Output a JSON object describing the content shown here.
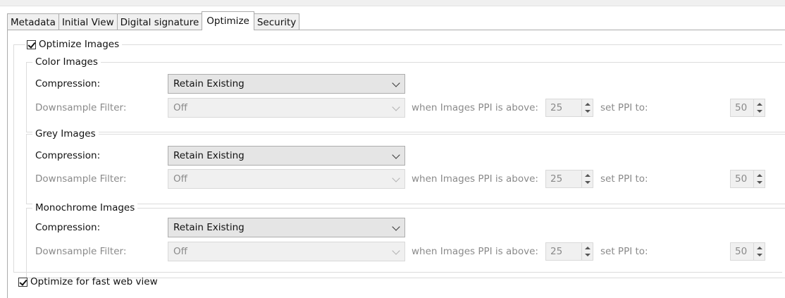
{
  "tabs": [
    "Metadata",
    "Initial View",
    "Digital signature",
    "Optimize",
    "Security"
  ],
  "optimize_images": {
    "label": "Optimize Images",
    "checked": true
  },
  "groups": [
    {
      "title": "Color Images",
      "compression_label": "Compression:",
      "compression_value": "Retain Existing",
      "downsample_label": "Downsample Filter:",
      "downsample_value": "Off",
      "when_label": "when Images PPI is above:",
      "above_value": "25",
      "set_label": "set PPI to:",
      "set_value": "50"
    },
    {
      "title": "Grey Images",
      "compression_label": "Compression:",
      "compression_value": "Retain Existing",
      "downsample_label": "Downsample Filter:",
      "downsample_value": "Off",
      "when_label": "when Images PPI is above:",
      "above_value": "25",
      "set_label": "set PPI to:",
      "set_value": "50"
    },
    {
      "title": "Monochrome Images",
      "compression_label": "Compression:",
      "compression_value": "Retain Existing",
      "downsample_label": "Downsample Filter:",
      "downsample_value": "Off",
      "when_label": "when Images PPI is above:",
      "above_value": "25",
      "set_label": "set PPI to:",
      "set_value": "50"
    }
  ],
  "fast_web_view": {
    "label": "Optimize for fast web view",
    "checked": true
  }
}
